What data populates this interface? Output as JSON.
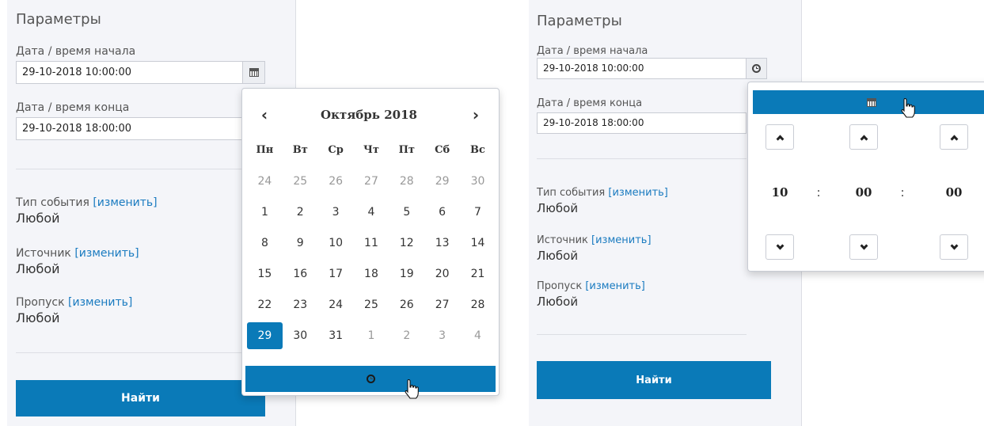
{
  "params": {
    "title": "Параметры",
    "start_label": "Дата / время начала",
    "start_value": "29-10-2018 10:00:00",
    "end_label": "Дата / время конца",
    "end_value": "29-10-2018 18:00:00",
    "filters": [
      {
        "label": "Тип события",
        "link": "[изменить]",
        "value": "Любой"
      },
      {
        "label": "Источник",
        "link": "[изменить]",
        "value": "Любой"
      },
      {
        "label": "Пропуск",
        "link": "[изменить]",
        "value": "Любой"
      }
    ],
    "search_button": "Найти"
  },
  "icons": {
    "date_addon": "calendar-icon",
    "time_addon": "clock-icon",
    "prev": "chevron-left-icon",
    "next": "chevron-right-icon",
    "up": "chevron-up-icon",
    "down": "chevron-down-icon",
    "cursor": "hand-pointer-icon"
  },
  "calendar": {
    "prev": "‹",
    "next": "›",
    "month": "Октябрь 2018",
    "weekdays": [
      "Пн",
      "Вт",
      "Ср",
      "Чт",
      "Пт",
      "Сб",
      "Вс"
    ],
    "weeks": [
      [
        "24",
        "25",
        "26",
        "27",
        "28",
        "29",
        "30"
      ],
      [
        "1",
        "2",
        "3",
        "4",
        "5",
        "6",
        "7"
      ],
      [
        "8",
        "9",
        "10",
        "11",
        "12",
        "13",
        "14"
      ],
      [
        "15",
        "16",
        "17",
        "18",
        "19",
        "20",
        "21"
      ],
      [
        "22",
        "23",
        "24",
        "25",
        "26",
        "27",
        "28"
      ],
      [
        "29",
        "30",
        "31",
        "1",
        "2",
        "3",
        "4"
      ]
    ],
    "selected": "29"
  },
  "time": {
    "hours": "10",
    "minutes": "00",
    "seconds": "00",
    "separator": ":"
  },
  "colors": {
    "accent": "#0a7ab8",
    "panel_bg": "#f4f5f9",
    "link": "#1a7bc0"
  }
}
